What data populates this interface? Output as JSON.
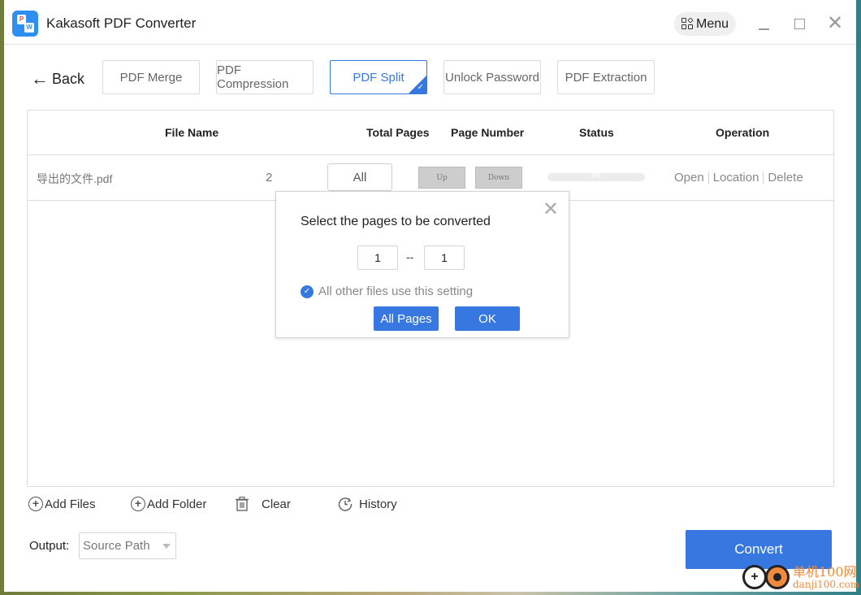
{
  "app": {
    "title": "Kakasoft PDF Converter",
    "icon_letters": {
      "top": "P",
      "bottom": "W"
    },
    "menu_label": "Menu",
    "close_glyph": "✕"
  },
  "nav": {
    "back_label": "Back",
    "back_glyph": "←",
    "tabs": [
      {
        "label": "PDF Merge",
        "active": false
      },
      {
        "label": "PDF Compression",
        "active": false
      },
      {
        "label": "PDF Split",
        "active": true
      },
      {
        "label": "Unlock Password",
        "active": false
      },
      {
        "label": "PDF Extraction",
        "active": false
      }
    ],
    "active_check_glyph": "✓"
  },
  "table": {
    "headers": {
      "file_name": "File Name",
      "total_pages": "Total Pages",
      "page_number": "Page Number",
      "status": "Status",
      "operation": "Operation"
    },
    "rows": [
      {
        "file_name": "导出的文件.pdf",
        "total_pages": "2",
        "page_selection": "All",
        "up_label": "Up",
        "down_label": "Down",
        "progress_percent": 0,
        "progress_text": "0%",
        "operations": [
          "Open",
          "Location",
          "Delete"
        ]
      }
    ]
  },
  "dialog": {
    "title": "Select the pages to be converted",
    "close_glyph": "✕",
    "from_page": "1",
    "range_separator": "--",
    "to_page": "1",
    "apply_all_checked": true,
    "apply_all_label": "All other files use this setting",
    "check_glyph": "✓",
    "all_pages_label": "All Pages",
    "ok_label": "OK"
  },
  "bottom": {
    "add_files_label": "Add Files",
    "add_folder_label": "Add Folder",
    "clear_label": "Clear",
    "history_label": "History",
    "plus_glyph": "+",
    "output_label": "Output:",
    "output_value": "Source Path",
    "convert_label": "Convert"
  },
  "watermark": {
    "line1": "单机100网",
    "line2": "danji100.com",
    "plus_glyph": "+"
  },
  "colors": {
    "accent": "#3778e0",
    "watermark": "#f08a3c"
  }
}
